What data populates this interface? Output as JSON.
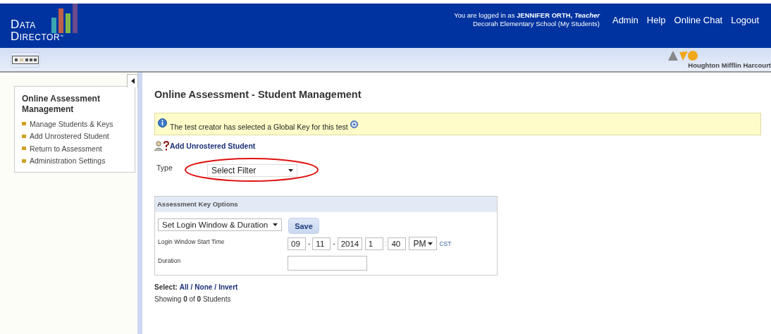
{
  "header": {
    "logo": {
      "line1": "Data",
      "line2": "Director",
      "mark": "™"
    },
    "user_line": {
      "prefix": "You are logged in as ",
      "name": "JENNIFER ORTH,",
      "role": "Teacher"
    },
    "school": "Decorah Elementary School (My Students)",
    "nav": [
      "Admin",
      "Help",
      "Online Chat",
      "Logout"
    ]
  },
  "subbar": {
    "brand": "Houghton Mifflin Harcourt"
  },
  "sidebar": {
    "title": "Online Assessment Management",
    "items": [
      "Manage Students & Keys",
      "Add Unrostered Student",
      "Return to Assessment",
      "Administration Settings"
    ]
  },
  "main": {
    "title": "Online Assessment - Student Management",
    "notice": "The test creator has selected a Global Key for this test",
    "add_link": "Add Unrostered Student",
    "type_label": "Type",
    "type_select": "Select Filter",
    "type_highlighted": true,
    "key_options": {
      "title": "Assessment Key Options",
      "action_select": "Set Login Window & Duration",
      "save": "Save",
      "start_label": "Login Window Start Time",
      "month": "09",
      "day": "11",
      "year": "2014",
      "hour": "1",
      "date_sep": "-",
      "time_sep": ":",
      "minute": "40",
      "ampm": "PM",
      "tz": "CST",
      "duration_label": "Duration"
    },
    "select_label": "Select:",
    "select_links": [
      "All",
      "None",
      "Invert"
    ],
    "link_sep": "/",
    "showing": "Showing **0** of **0** Students"
  }
}
